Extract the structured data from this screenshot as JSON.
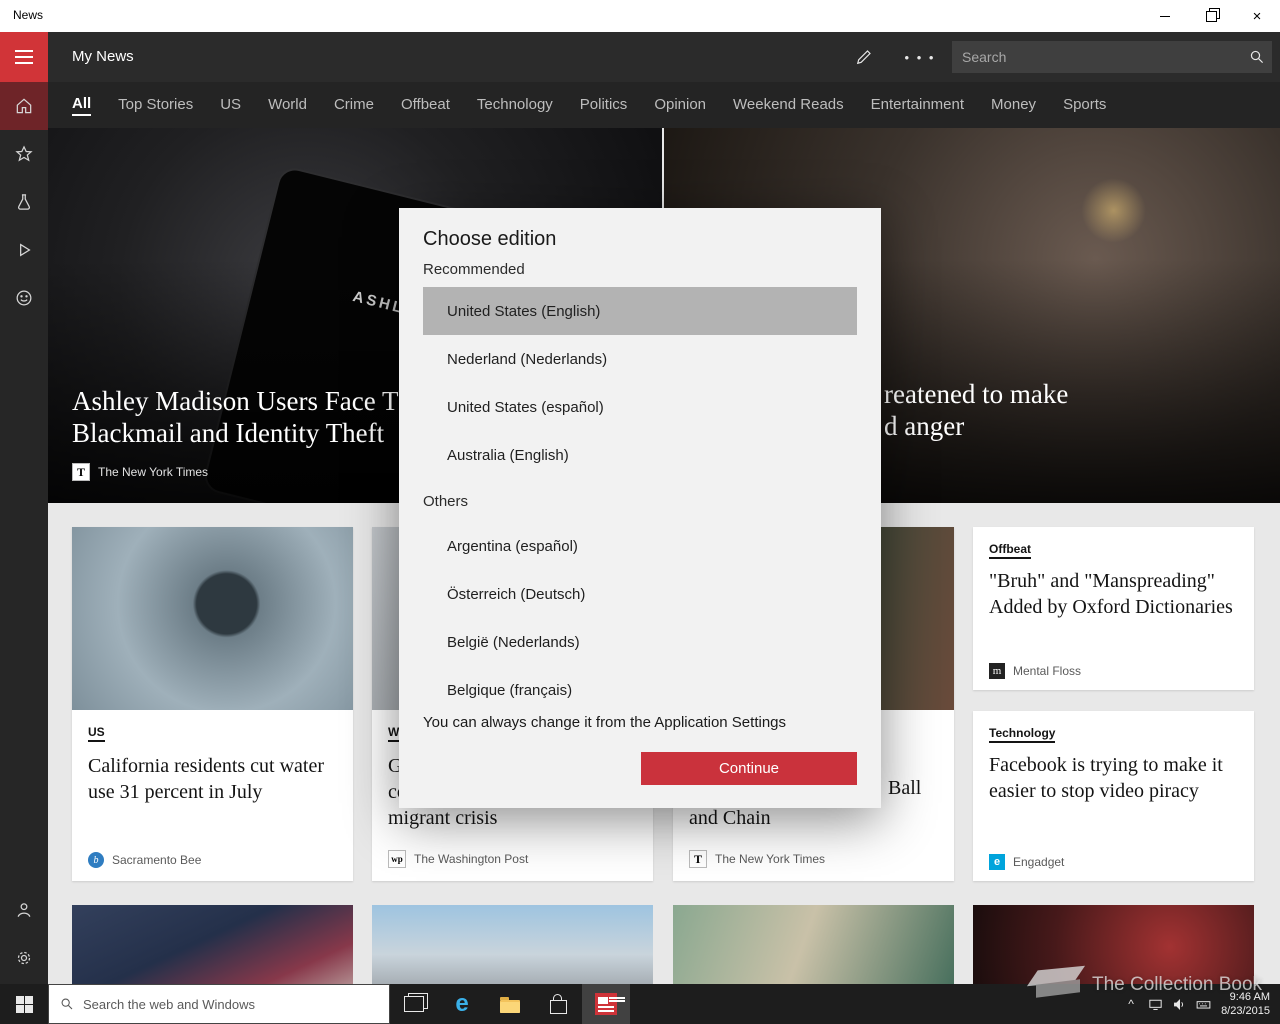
{
  "titlebar": {
    "title": "News"
  },
  "header": {
    "title": "My News",
    "search_placeholder": "Search"
  },
  "icons": {
    "more": "• • •",
    "tray_chevron": "^",
    "edge_glyph": "e",
    "nyt_glyph": "T",
    "wapo_glyph": "wp",
    "sacbee_glyph": "b",
    "mentalfloss_glyph": "m",
    "engadget_glyph": "e"
  },
  "nav": {
    "selected": "All",
    "tabs": [
      "All",
      "Top Stories",
      "US",
      "World",
      "Crime",
      "Offbeat",
      "Technology",
      "Politics",
      "Opinion",
      "Weekend Reads",
      "Entertainment",
      "Money",
      "Sports"
    ]
  },
  "hero_left": {
    "image_text": "ASHL",
    "line1": "Ashley Madison Users Face Th",
    "line2": "Blackmail and Identity Theft",
    "source": "The New York Times"
  },
  "hero_right": {
    "line1": "reatened to make",
    "line2": "d anger"
  },
  "cards": [
    {
      "category": "US",
      "title": "California residents cut water use 31 percent in July",
      "source": "Sacramento Bee"
    },
    {
      "category": "W",
      "line1": "G",
      "line2": "co",
      "line3": "migrant crisis",
      "source": "The Washington Post"
    },
    {
      "line1": "Ball",
      "line2": "and Chain",
      "source": "The New York Times"
    },
    {
      "category": "Offbeat",
      "title": "\"Bruh\" and \"Manspreading\" Added by Oxford Dictionaries",
      "source": "Mental Floss"
    },
    {
      "category": "Technology",
      "title": "Facebook is trying to make it easier to stop video piracy",
      "source": "Engadget"
    }
  ],
  "dialog": {
    "title": "Choose edition",
    "recommended_label": "Recommended",
    "recommended": [
      "United States (English)",
      "Nederland (Nederlands)",
      "United States (español)",
      "Australia (English)"
    ],
    "others_label": "Others",
    "others": [
      "Argentina (español)",
      "Österreich (Deutsch)",
      "België (Nederlands)",
      "Belgique (français)"
    ],
    "selected_option": "United States (English)",
    "note": "You can always change it from the Application Settings",
    "continue_label": "Continue"
  },
  "taskbar": {
    "search_placeholder": "Search the web and Windows",
    "time": "9:46 AM",
    "date": "8/23/2015"
  },
  "watermark": {
    "text": "The Collection Book"
  },
  "colors": {
    "accent_red": "#d13438",
    "header_bg": "#2b2b2b",
    "dialog_bg": "#f2f2f2",
    "selected_option_bg": "#b3b3b3",
    "continue_button": "#ca323c",
    "taskbar_bg": "#1d1d1d"
  }
}
